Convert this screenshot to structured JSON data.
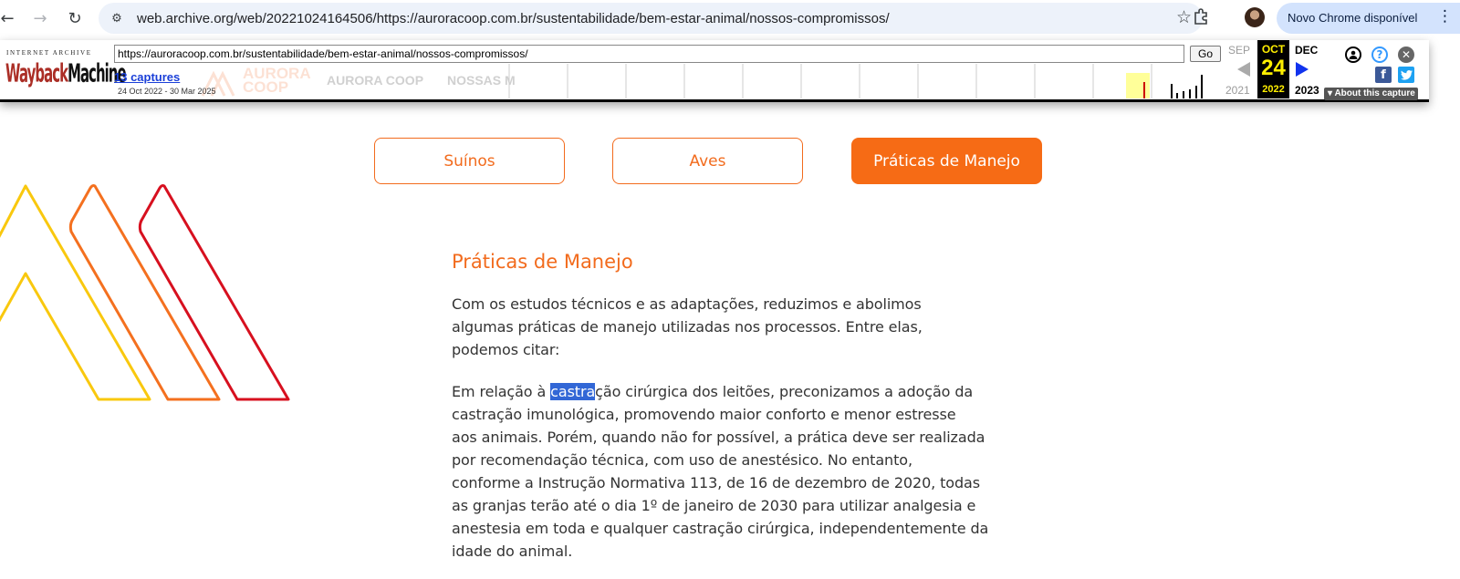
{
  "browser": {
    "url": "web.archive.org/web/20221024164506/https://auroracoop.com.br/sustentabilidade/bem-estar-animal/nossos-compromissos/",
    "update_label": "Novo Chrome disponível"
  },
  "wayback": {
    "logo_top": "INTERNET ARCHIVE",
    "logo_main_a": "Wayback",
    "logo_main_b": "Machine",
    "url_value": "https://auroracoop.com.br/sustentabilidade/bem-estar-animal/nossos-compromissos/",
    "go_label": "Go",
    "captures_label": "13 captures",
    "date_range": "24 Oct 2022 - 30 Mar 2025",
    "prev_month": "SEP",
    "prev_year": "2021",
    "cur_month": "OCT",
    "cur_day": "24",
    "cur_year": "2022",
    "next_month": "DEC",
    "next_year": "2023",
    "about_label": "About this capture",
    "ghost_brand": "AURORA COOP",
    "ghost_nav_1": "AURORA COOP",
    "ghost_nav_2": "NOSSAS M"
  },
  "tabs": [
    {
      "label": "Suínos",
      "active": false
    },
    {
      "label": "Aves",
      "active": false
    },
    {
      "label": "Práticas de Manejo",
      "active": true
    }
  ],
  "content": {
    "title": "Práticas de Manejo",
    "intro_lines": [
      "Com os estudos técnicos e as adaptações, reduzimos e abolimos",
      "algumas práticas de manejo utilizadas nos processos. Entre elas,",
      "podemos citar:"
    ],
    "body_line1_pre": "Em relação à ",
    "body_line1_sel": "castra",
    "body_line1_post": "ção cirúrgica dos leitões, preconizamos a adoção da",
    "body_lines": [
      "castração imunológica, promovendo maior conforto e menor estresse",
      "aos animais. Porém, quando não for possível, a prática deve ser realizada",
      "por recomendação técnica, com uso de anestésico. No entanto,",
      "conforme a Instrução Normativa 113, de 16 de dezembro de 2020, todas",
      "as granjas terão até o dia 1º de janeiro de 2030 para utilizar analgesia e",
      "anestesia em toda e qualquer castração cirúrgica, independentemente da",
      "idade do animal."
    ]
  },
  "colors": {
    "accent": "#f26b1d",
    "decor_yellow": "#f9c80e",
    "decor_orange": "#f4701f",
    "decor_red": "#d7101f"
  }
}
